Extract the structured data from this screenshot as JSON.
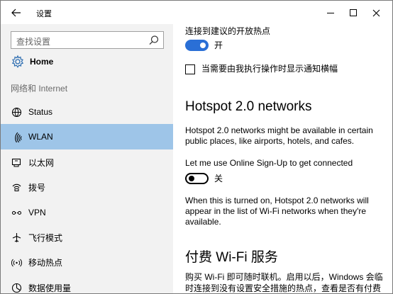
{
  "window": {
    "title": "设置"
  },
  "sidebar": {
    "search_placeholder": "查找设置",
    "home_label": "Home",
    "section_label": "网络和 Internet",
    "items": [
      {
        "label": "Status",
        "icon": "globe-icon",
        "active": false
      },
      {
        "label": "WLAN",
        "icon": "wifi-icon",
        "active": true
      },
      {
        "label": "以太网",
        "icon": "ethernet-icon",
        "active": false
      },
      {
        "label": "拨号",
        "icon": "dialup-icon",
        "active": false
      },
      {
        "label": "VPN",
        "icon": "vpn-icon",
        "active": false
      },
      {
        "label": "飞行模式",
        "icon": "airplane-icon",
        "active": false
      },
      {
        "label": "移动热点",
        "icon": "hotspot-icon",
        "active": false
      },
      {
        "label": "数据使用量",
        "icon": "data-usage-icon",
        "active": false
      }
    ]
  },
  "content": {
    "connect_suggested_label": "连接到建议的开放热点",
    "connect_suggested_toggle": {
      "state_text": "开",
      "on": true
    },
    "notify_checkbox_label": "当需要由我执行操作时显示通知横幅",
    "notify_checked": false,
    "hotspot_heading": "Hotspot 2.0 networks",
    "hotspot_desc_line1": "Hotspot 2.0 networks might be available in certain",
    "hotspot_desc_line2": "public places, like airports, hotels, and cafes.",
    "online_signup_label": "Let me use Online Sign-Up to get connected",
    "online_signup_toggle": {
      "state_text": "关",
      "on": false
    },
    "when_on_line1": "When this is turned on, Hotspot 2.0 networks will",
    "when_on_line2": "appear in the list of Wi-Fi networks when they're",
    "when_on_line3": "available.",
    "paid_heading": "付费 Wi-Fi 服务",
    "paid_desc_line1": "购买 Wi-Fi 即可随时联机。启用以后，Windows 会临",
    "paid_desc_line2": "时连接到没有设置安全措施的热点，查看是否有付费"
  },
  "colors": {
    "sidebar_bg": "#f2f2f2",
    "active_item_bg": "#9ec5e8",
    "toggle_on": "#2a6fd6"
  }
}
